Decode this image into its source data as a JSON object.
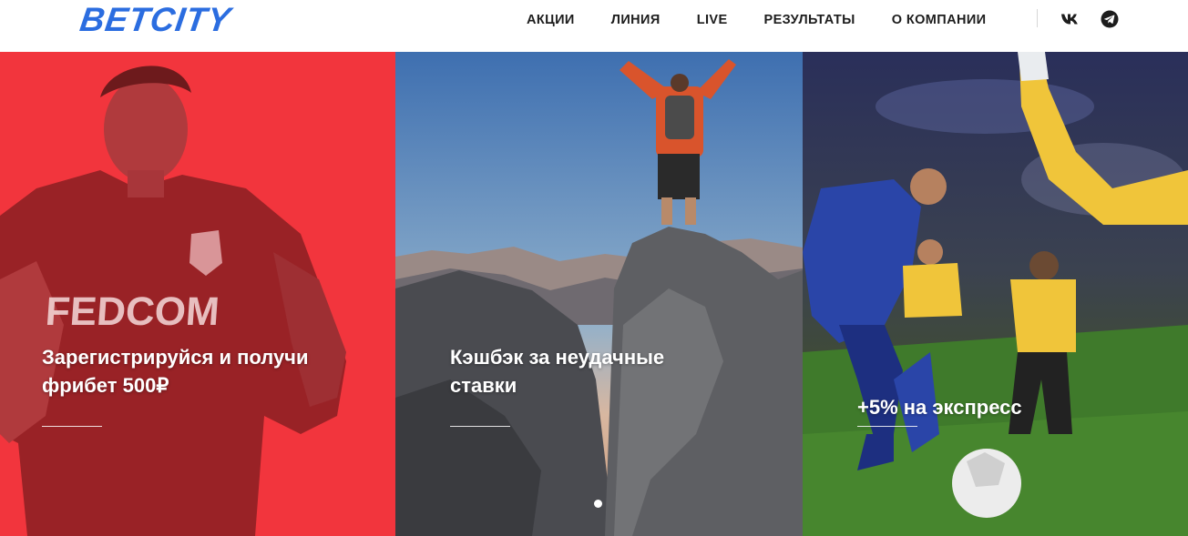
{
  "logo": {
    "text": "BETCITY",
    "color": "#2b6de0"
  },
  "nav": {
    "items": [
      {
        "label": "АКЦИИ"
      },
      {
        "label": "ЛИНИЯ"
      },
      {
        "label": "LIVE"
      },
      {
        "label": "РЕЗУЛЬТАТЫ"
      },
      {
        "label": "О КОМПАНИИ"
      }
    ]
  },
  "social": {
    "vk_icon": "vk-icon",
    "telegram_icon": "telegram-icon"
  },
  "promos": [
    {
      "line1": "Зарегистрируйся и получи",
      "line2": "фрибет 500₽",
      "accent": "#f2353d"
    },
    {
      "line1": "Кэшбэк за неудачные",
      "line2": "ставки"
    },
    {
      "line1": "+5% на экспресс"
    }
  ],
  "slider": {
    "active_index": 1
  }
}
